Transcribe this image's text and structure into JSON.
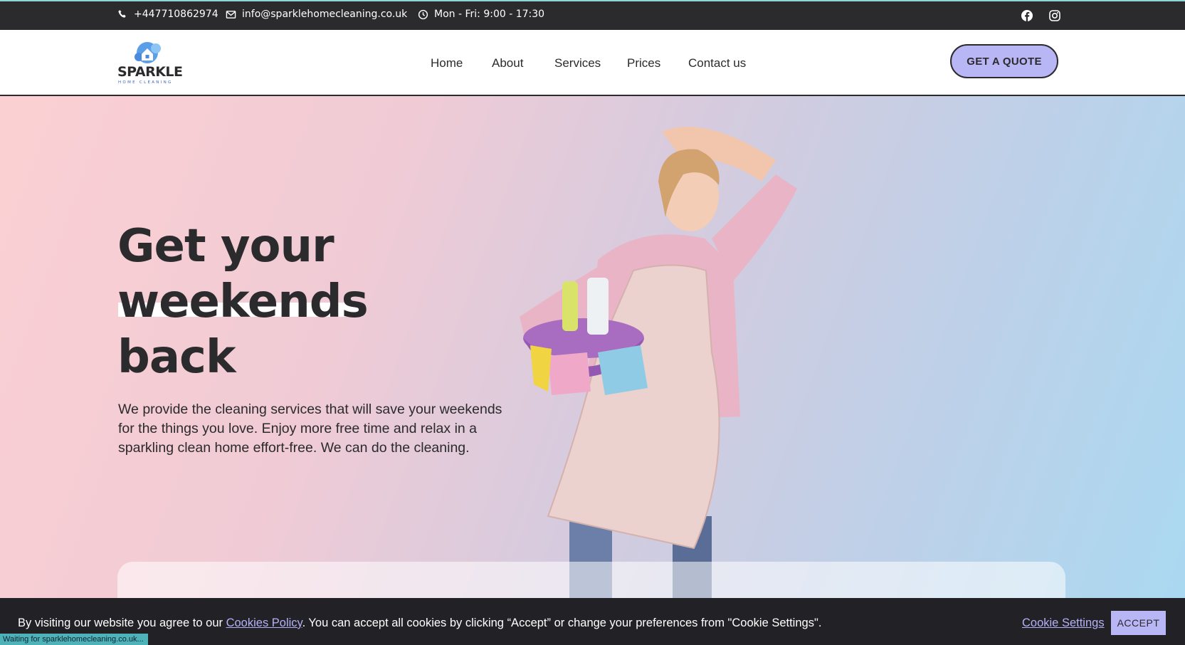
{
  "topbar": {
    "phone": "+447710862974",
    "email": "info@sparklehomecleaning.co.uk",
    "hours": "Mon - Fri: 9:00 - 17:30"
  },
  "header": {
    "logo_word": "SPARKLE",
    "logo_sub": "HOME CLEANING",
    "nav": [
      "Home",
      "About",
      "Services",
      "Prices",
      "Contact us"
    ],
    "quote_button": "GET A QUOTE"
  },
  "hero": {
    "title_lines": [
      "Get your",
      "weekends",
      "back"
    ],
    "paragraph": "We provide the cleaning services that will save your weekends for the things you love. Enjoy more free time and relax in a sparkling clean home effort-free. We can do the cleaning."
  },
  "cookie": {
    "text_before": "By visiting our website you agree to our ",
    "policy_link": "Cookies Policy",
    "text_after": ". You can accept all cookies by clicking “Accept” or change your preferences from \"Cookie Settings\".",
    "settings_link": "Cookie Settings",
    "accept_button": "ACCEPT"
  },
  "status_bar": "Waiting for sparklehomecleaning.co.uk...",
  "colors": {
    "dark": "#2b2a2d",
    "accent": "#b9b6f5",
    "logo_blue": "#3a64c8"
  }
}
